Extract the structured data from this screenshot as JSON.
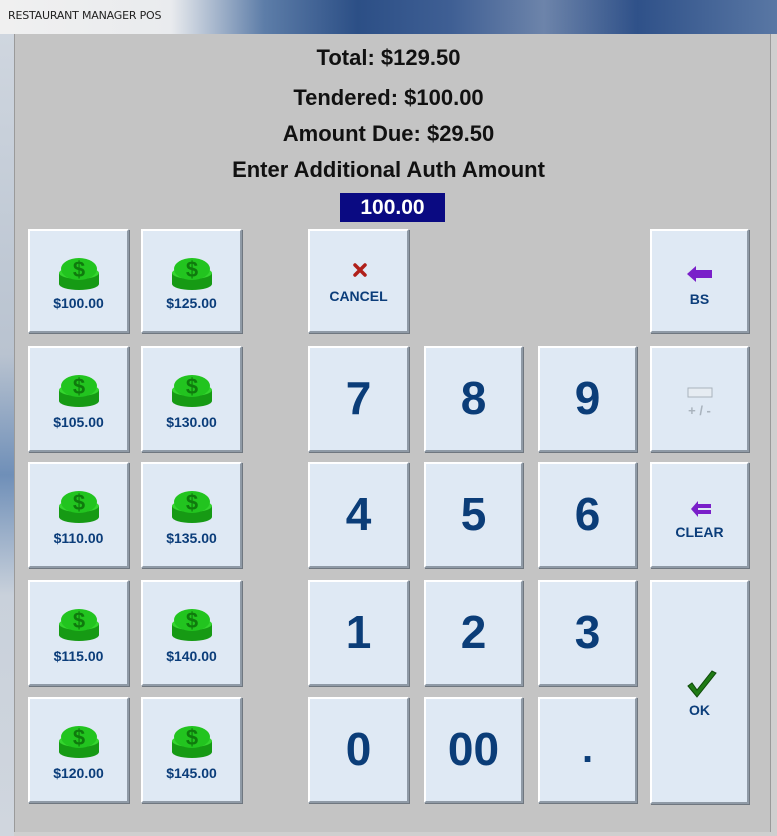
{
  "window": {
    "title": "RESTAURANT MANAGER POS"
  },
  "summary": {
    "total": "Total: $129.50",
    "tendered": "Tendered: $100.00",
    "amount_due": "Amount Due: $29.50",
    "prompt": "Enter Additional Auth Amount",
    "entry_value": "100.00"
  },
  "quick_amounts": [
    "$100.00",
    "$125.00",
    "$105.00",
    "$130.00",
    "$110.00",
    "$135.00",
    "$115.00",
    "$140.00",
    "$120.00",
    "$145.00"
  ],
  "keypad": {
    "cancel": "CANCEL",
    "backspace": "BS",
    "plus_minus": "+ / -",
    "clear": "CLEAR",
    "ok": "OK",
    "digits": [
      "7",
      "8",
      "9",
      "4",
      "5",
      "6",
      "1",
      "2",
      "3",
      "0",
      "00",
      "."
    ]
  },
  "colors": {
    "money_icon": "#22c41f",
    "entry_bg": "#0a0a82",
    "digit_text": "#0b3d78",
    "cancel_icon": "#b0201a",
    "arrow_icon": "#7a1fc9",
    "ok_icon": "#1f7a14"
  }
}
